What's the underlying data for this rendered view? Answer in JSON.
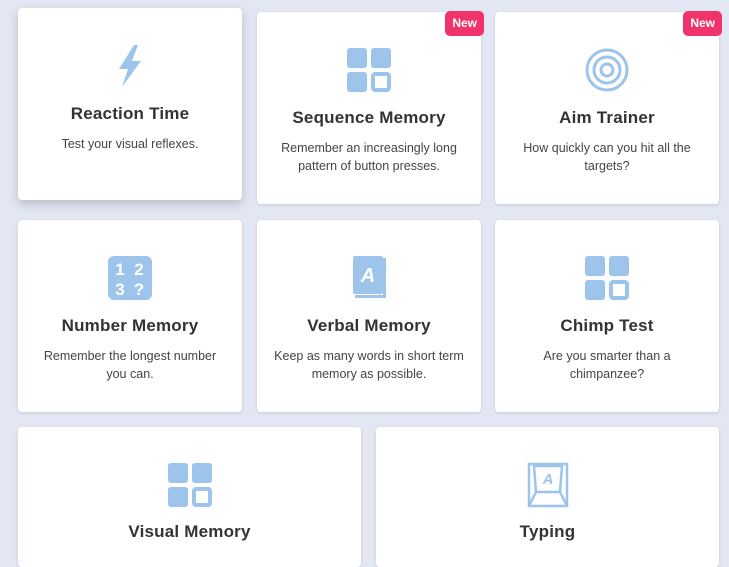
{
  "colors": {
    "background": "#e3e6f3",
    "card": "#ffffff",
    "icon": "#9dc4ea",
    "badge": "#f0346b"
  },
  "cards": [
    {
      "title": "Reaction Time",
      "description": "Test your visual reflexes.",
      "icon": "lightning-icon",
      "badge": ""
    },
    {
      "title": "Sequence Memory",
      "description": "Remember an increasingly long pattern of button presses.",
      "icon": "grid-icon",
      "badge": "New"
    },
    {
      "title": "Aim Trainer",
      "description": "How quickly can you hit all the targets?",
      "icon": "target-icon",
      "badge": "New"
    },
    {
      "title": "Number Memory",
      "description": "Remember the longest number you can.",
      "icon": "number-icon",
      "badge": ""
    },
    {
      "title": "Verbal Memory",
      "description": "Keep as many words in short term memory as possible.",
      "icon": "book-icon",
      "badge": ""
    },
    {
      "title": "Chimp Test",
      "description": "Are you smarter than a chimpanzee?",
      "icon": "grid-icon",
      "badge": ""
    },
    {
      "title": "Visual Memory",
      "description": "",
      "icon": "grid-icon",
      "badge": ""
    },
    {
      "title": "Typing",
      "description": "",
      "icon": "keyboard-key-icon",
      "badge": ""
    }
  ],
  "icon_text": {
    "number": [
      "1",
      "2",
      "3",
      "?"
    ],
    "book_letter": "A",
    "key_letter": "A"
  }
}
